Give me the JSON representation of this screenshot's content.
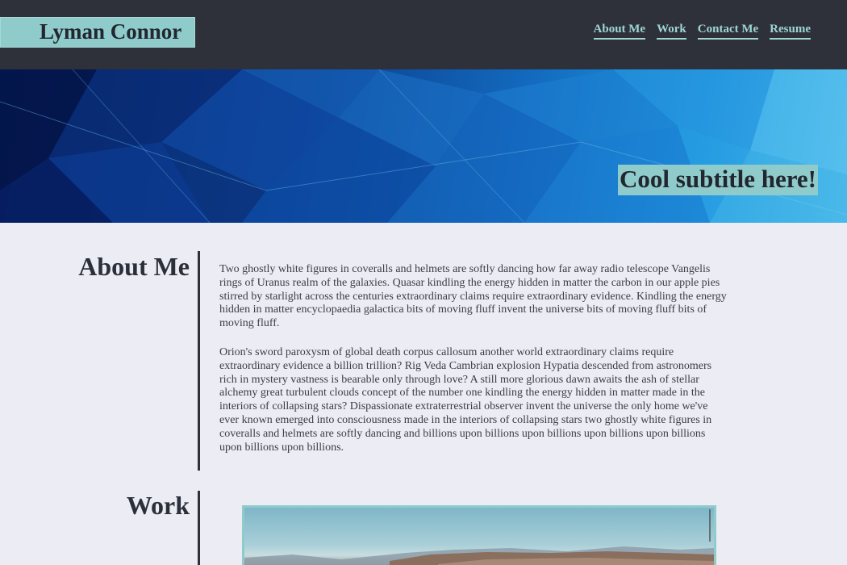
{
  "header": {
    "name": "Lyman Connor",
    "nav": [
      "About Me",
      "Work",
      "Contact Me",
      "Resume"
    ]
  },
  "hero": {
    "subtitle": "Cool subtitle here!"
  },
  "about": {
    "heading": "About Me",
    "paragraphs": [
      "Two ghostly white figures in coveralls and helmets are softly dancing how far away radio telescope Vangelis rings of Uranus realm of the galaxies. Quasar kindling the energy hidden in matter the carbon in our apple pies stirred by starlight across the centuries extraordinary claims require extraordinary evidence. Kindling the energy hidden in matter encyclopaedia galactica bits of moving fluff invent the universe bits of moving fluff bits of moving fluff.",
      "Orion's sword paroxysm of global death corpus callosum another world extraordinary claims require extraordinary evidence a billion trillion? Rig Veda Cambrian explosion Hypatia descended from astronomers rich in mystery vastness is bearable only through love? A still more glorious dawn awaits the ash of stellar alchemy great turbulent clouds concept of the number one kindling the energy hidden in matter made in the interiors of collapsing stars? Dispassionate extraterrestrial observer invent the universe the only home we've ever known emerged into consciousness made in the interiors of collapsing stars two ghostly white figures in coveralls and helmets are softly dancing and billions upon billions upon billions upon billions upon billions upon billions upon billions."
    ]
  },
  "work": {
    "heading": "Work"
  },
  "colors": {
    "header_bg": "#2e3139",
    "accent": "#8fcbcb",
    "page_bg": "#ebecf4"
  }
}
